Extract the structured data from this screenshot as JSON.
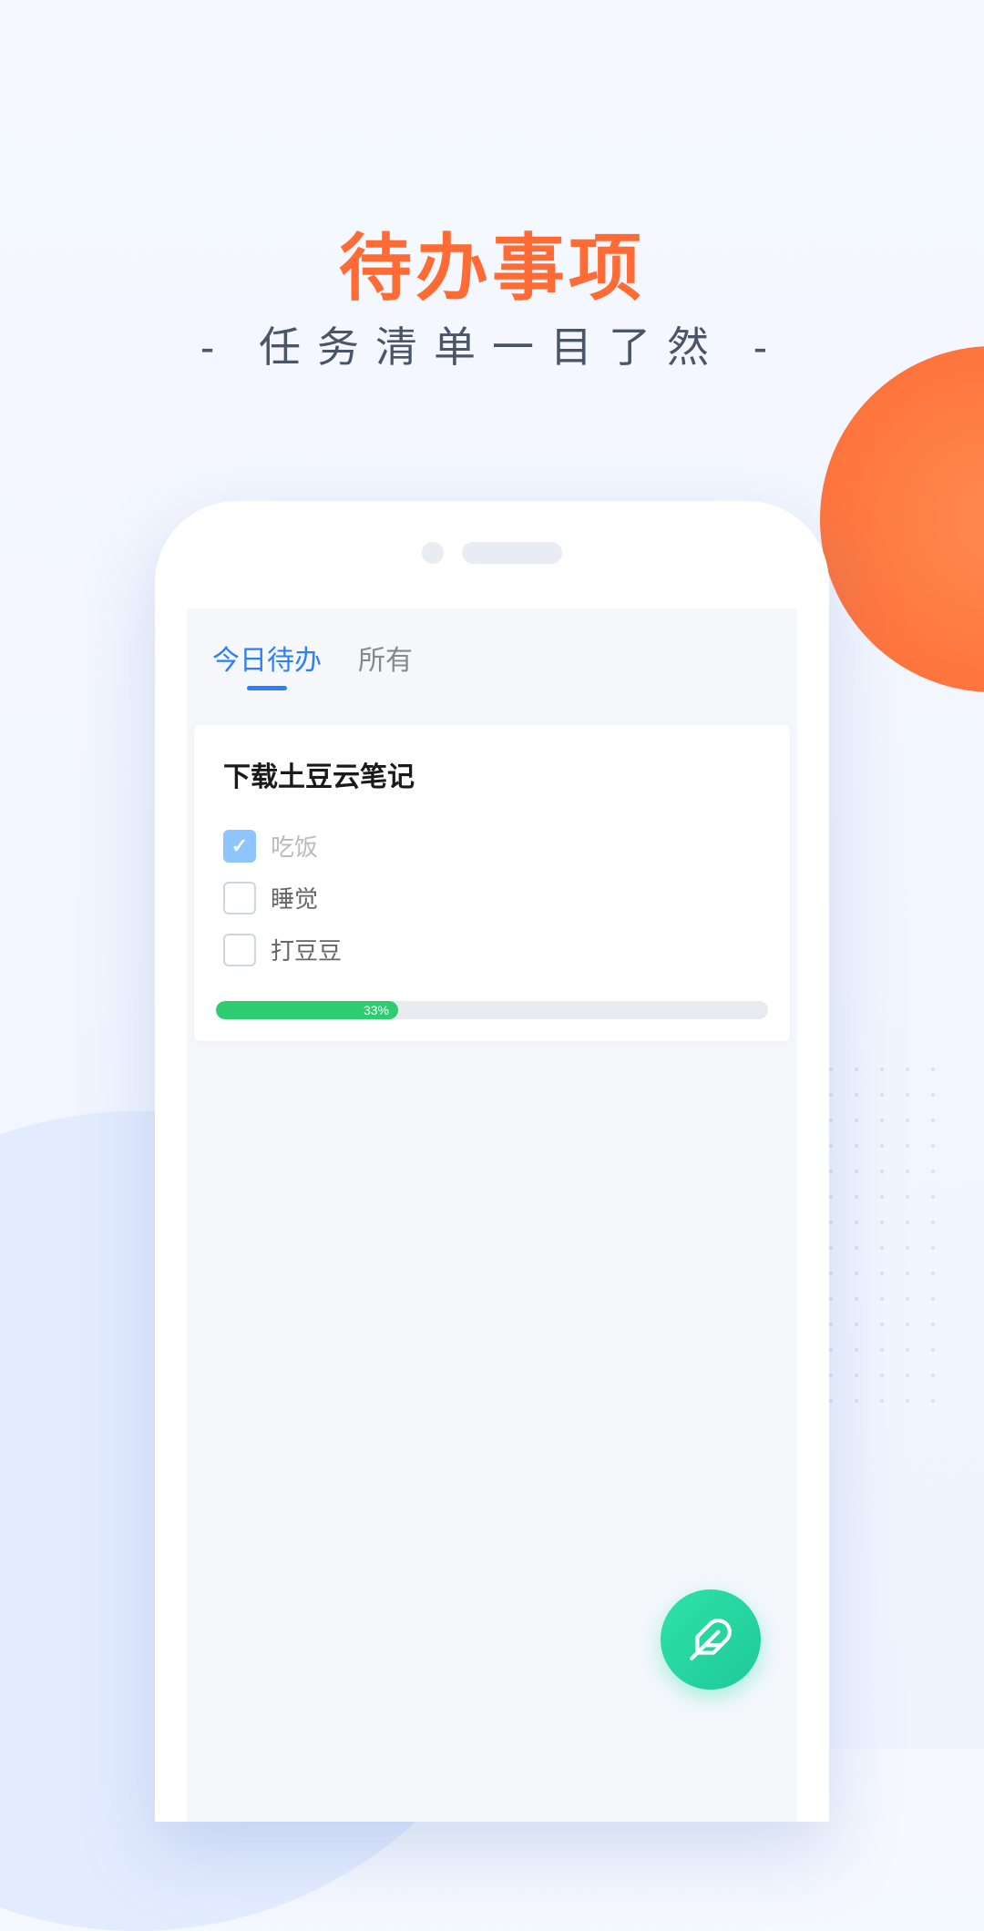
{
  "hero": {
    "title": "待办事项",
    "subtitle": "- 任务清单一目了然 -"
  },
  "tabs": [
    {
      "label": "今日待办",
      "active": true
    },
    {
      "label": "所有",
      "active": false
    }
  ],
  "card": {
    "title": "下载土豆云笔记",
    "todos": [
      {
        "label": "吃饭",
        "checked": true
      },
      {
        "label": "睡觉",
        "checked": false
      },
      {
        "label": "打豆豆",
        "checked": false
      }
    ],
    "progress": {
      "percent": 33,
      "label": "33%"
    }
  }
}
